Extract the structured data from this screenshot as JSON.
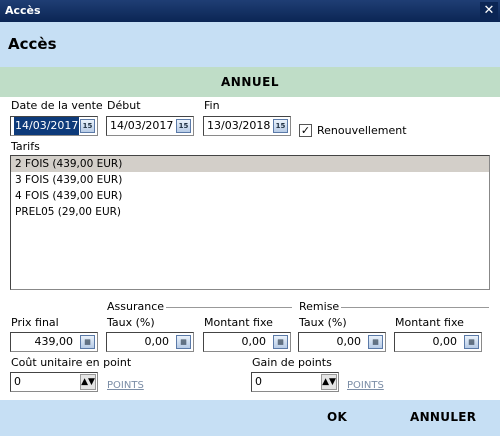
{
  "window": {
    "title": "Accès",
    "close_glyph": "✕"
  },
  "header": {
    "title": "Accès"
  },
  "section": {
    "title": "ANNUEL"
  },
  "dates": {
    "vente": {
      "label": "Date de la vente",
      "value": "14/03/2017"
    },
    "debut": {
      "label": "Début",
      "value": "14/03/2017"
    },
    "fin": {
      "label": "Fin",
      "value": "13/03/2018"
    },
    "calendar_glyph": "15"
  },
  "renouvellement": {
    "label": "Renouvellement",
    "checked": true,
    "check_glyph": "✓"
  },
  "tarifs": {
    "label": "Tarifs",
    "items": [
      {
        "label": "2 FOIS (439,00 EUR)",
        "selected": true
      },
      {
        "label": "3 FOIS (439,00 EUR)",
        "selected": false
      },
      {
        "label": "4 FOIS (439,00 EUR)",
        "selected": false
      },
      {
        "label": "PREL05 (29,00 EUR)",
        "selected": false
      }
    ]
  },
  "pricing": {
    "prix_final": {
      "label": "Prix final",
      "value": "439,00"
    },
    "assurance": {
      "group_label": "Assurance",
      "taux": {
        "label": "Taux (%)",
        "value": "0,00"
      },
      "montant": {
        "label": "Montant fixe",
        "value": "0,00"
      }
    },
    "remise": {
      "group_label": "Remise",
      "taux": {
        "label": "Taux (%)",
        "value": "0,00"
      },
      "montant": {
        "label": "Montant fixe",
        "value": "0,00"
      }
    },
    "calc_glyph": "▦"
  },
  "points": {
    "cout": {
      "label": "Coût unitaire en point",
      "value": "0",
      "unit": "POINTS"
    },
    "gain": {
      "label": "Gain de points",
      "value": "0",
      "unit": "POINTS"
    },
    "spin_glyph": "▲▼"
  },
  "footer": {
    "ok_label": "OK",
    "cancel_label": "ANNULER"
  }
}
